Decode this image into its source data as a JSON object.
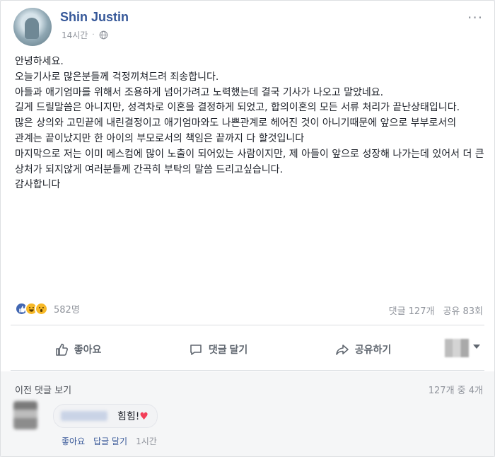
{
  "post": {
    "author": "Shin Justin",
    "time": "14시간",
    "more_icon": "ellipsis-icon",
    "lines": [
      "안녕하세요.",
      "오늘기사로 많은분들께 걱정끼쳐드려 죄송합니다.",
      "아들과 애기엄마를 위해서 조용하게 넘어가려고 노력했는데 결국 기사가 나오고 말았네요.",
      "길게 드릴말씀은 아니지만, 성격차로 이혼을 결정하게 되었고, 합의이혼의 모든 서류 처리가 끝난상태입니다.",
      "많은 상의와 고민끝에 내린결정이고 애기엄마와도 나쁜관계로 헤어진 것이 아니기때문에 앞으로 부부로서의 관계는 끝이났지만 한 아이의 부모로서의 책임은 끝까지 다 할것입니다",
      "마지막으로 저는 이미 메스컴에 많이 노출이 되어있는 사람이지만, 제 아들이 앞으로 성장해 나가는데 있어서 더 큰 상처가 되지않게 여러분들께 간곡히 부탁의 말씀 드리고싶습니다.",
      "감사합니다"
    ]
  },
  "reactions": {
    "count": "582명",
    "icons": [
      "like-icon",
      "haha-icon",
      "wow-icon"
    ],
    "comments": "댓글 127개",
    "shares": "공유 83회"
  },
  "actions": {
    "like": "좋아요",
    "comment": "댓글 달기",
    "share": "공유하기"
  },
  "comments": {
    "previous": "이전 댓글 보기",
    "count": "127개 중 4개",
    "items": [
      {
        "text": "힘힘!",
        "like": "좋아요",
        "reply": "답글 달기",
        "time": "1시간"
      }
    ]
  },
  "colors": {
    "link": "#365899",
    "like": "#4267b2",
    "heart": "#f33e58",
    "muted": "#90949c"
  }
}
